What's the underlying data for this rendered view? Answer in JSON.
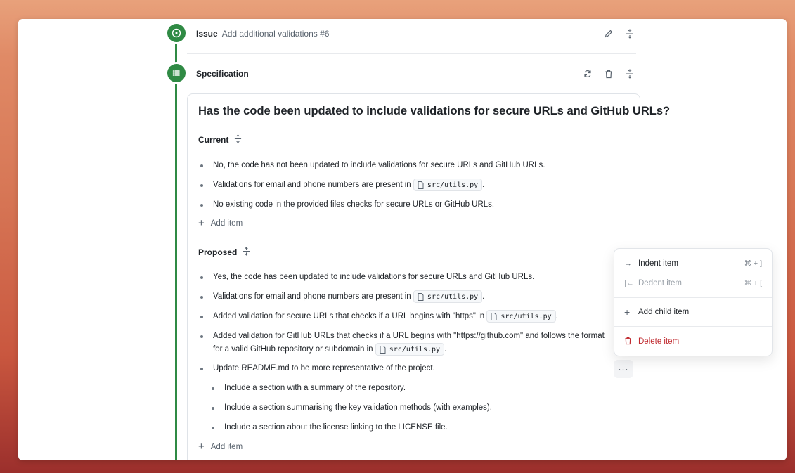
{
  "issue": {
    "label": "Issue",
    "title": "Add additional validations #6"
  },
  "spec": {
    "label": "Specification"
  },
  "question": "Has the code been updated to include validations for secure URLs and GitHub URLs?",
  "current": {
    "label": "Current",
    "items": [
      {
        "text": "No, the code has not been updated to include validations for secure URLs and GitHub URLs."
      },
      {
        "text": "Validations for email and phone numbers are present in",
        "code": "src/utils.py",
        "after": "."
      },
      {
        "text": "No existing code in the provided files checks for secure URLs or GitHub URLs."
      }
    ],
    "add_item": "Add item"
  },
  "proposed": {
    "label": "Proposed",
    "items": [
      {
        "text": "Yes, the code has been updated to include validations for secure URLs and GitHub URLs."
      },
      {
        "text": "Validations for email and phone numbers are present in",
        "code": "src/utils.py",
        "after": "."
      },
      {
        "text": "Added validation for secure URLs that checks if a URL begins with \"https\" in",
        "code": "src/utils.py",
        "after": "."
      },
      {
        "text": "Added validation for GitHub URLs that checks if a URL begins with \"https://github.com\" and follows the format for a valid GitHub repository or subdomain in",
        "code": "src/utils.py",
        "after": "."
      },
      {
        "text": "Update README.md to be more representative of the project."
      }
    ],
    "children": [
      {
        "text": "Include a section with a summary of the repository."
      },
      {
        "text": "Include a section summarising the key validation methods (with examples)."
      },
      {
        "text": "Include a section about the license linking to the LICENSE file."
      }
    ],
    "add_item": "Add item"
  },
  "more_button": "···",
  "menu": {
    "indent": {
      "label": "Indent item",
      "shortcut": "⌘ + ]"
    },
    "dedent": {
      "label": "Dedent item",
      "shortcut": "⌘ + ["
    },
    "add_child": {
      "label": "Add child item"
    },
    "delete": {
      "label": "Delete item"
    }
  },
  "colors": {
    "timeline": "#2f8a44",
    "danger": "#c02a2f"
  },
  "icons": [
    "issue-opened-icon",
    "list-icon",
    "pencil-icon",
    "unfold-icon",
    "sync-icon",
    "trash-icon",
    "file-icon",
    "plus-icon",
    "indent-icon",
    "dedent-icon"
  ]
}
